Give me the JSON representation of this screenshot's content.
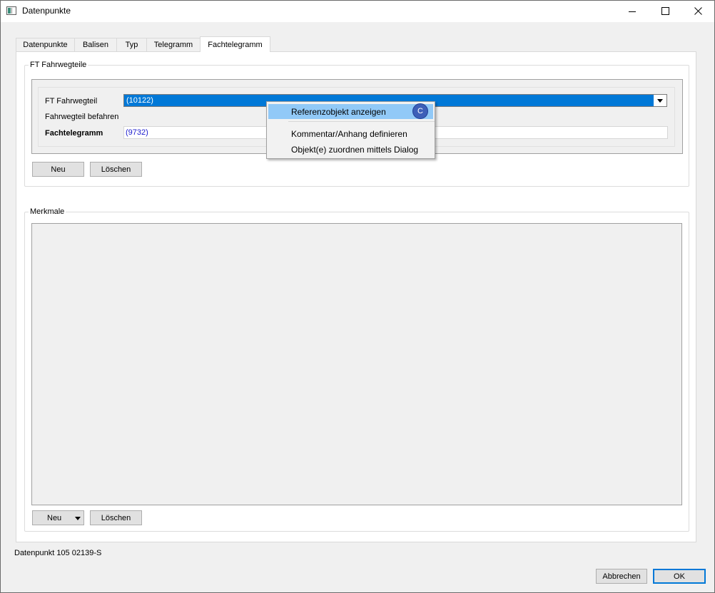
{
  "window": {
    "title": "Datenpunkte",
    "icon": "app-window-icon",
    "controls": [
      "minimize-icon",
      "maximize-icon",
      "close-icon"
    ]
  },
  "tabs": [
    {
      "label": "Datenpunkte",
      "active": false
    },
    {
      "label": "Balisen",
      "active": false
    },
    {
      "label": "Typ",
      "active": false
    },
    {
      "label": "Telegramm",
      "active": false
    },
    {
      "label": "Fachtelegramm",
      "active": true
    }
  ],
  "ft_group": {
    "title": "FT Fahrwegteile",
    "fields": {
      "fahrwegteil_label": "FT Fahrwegteil",
      "fahrwegteil_value": "(10122)",
      "befahren_label": "Fahrwegteil befahren",
      "fachtelegramm_label": "Fachtelegramm",
      "fachtelegramm_value": "(9732)"
    },
    "buttons": {
      "new": "Neu",
      "delete": "Löschen"
    }
  },
  "merkmale_group": {
    "title": "Merkmale",
    "buttons": {
      "new": "Neu",
      "delete": "Löschen"
    }
  },
  "context_menu": {
    "items": [
      {
        "label": "Referenzobjekt anzeigen",
        "highlighted": true
      },
      {
        "label": "Kommentar/Anhang definieren",
        "highlighted": false
      },
      {
        "label": "Objekt(e) zuordnen mittels Dialog",
        "highlighted": false
      }
    ],
    "badge": "C"
  },
  "status": {
    "text": "Datenpunkt 105 02139-S"
  },
  "dialog_buttons": {
    "cancel": "Abbrechen",
    "ok": "OK"
  },
  "colors": {
    "selection": "#0078d7",
    "menu_highlight": "#91c9f7",
    "link_value": "#1a1acd",
    "badge": "#3d5fb8"
  }
}
